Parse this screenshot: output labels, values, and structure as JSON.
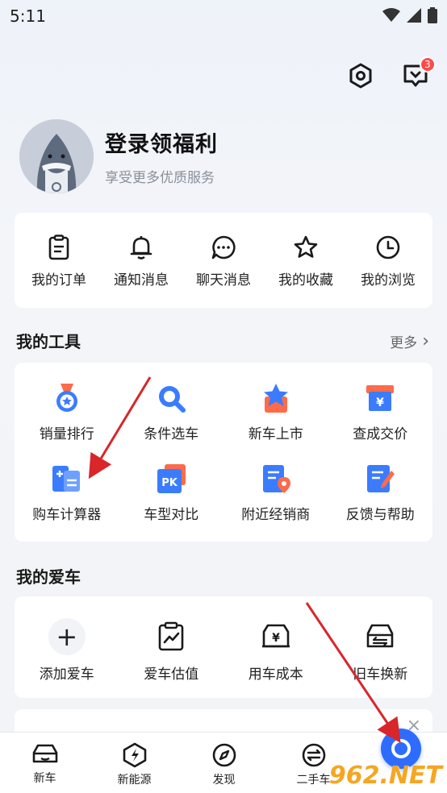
{
  "status": {
    "time": "5:11"
  },
  "header": {
    "messages_badge": "3"
  },
  "profile": {
    "title": "登录领福利",
    "subtitle": "享受更多优质服务"
  },
  "shortcuts": [
    {
      "label": "我的订单",
      "icon": "order-icon"
    },
    {
      "label": "通知消息",
      "icon": "bell-icon"
    },
    {
      "label": "聊天消息",
      "icon": "chat-icon"
    },
    {
      "label": "我的收藏",
      "icon": "star-icon"
    },
    {
      "label": "我的浏览",
      "icon": "clock-icon"
    }
  ],
  "tools": {
    "title": "我的工具",
    "more": "更多",
    "items": [
      {
        "label": "销量排行",
        "icon": "sales-rank-icon"
      },
      {
        "label": "条件选车",
        "icon": "filter-search-icon"
      },
      {
        "label": "新车上市",
        "icon": "new-car-star-icon"
      },
      {
        "label": "查成交价",
        "icon": "price-yen-icon"
      },
      {
        "label": "购车计算器",
        "icon": "calculator-icon"
      },
      {
        "label": "车型对比",
        "icon": "pk-compare-icon"
      },
      {
        "label": "附近经销商",
        "icon": "dealer-location-icon"
      },
      {
        "label": "反馈与帮助",
        "icon": "feedback-icon"
      }
    ]
  },
  "mycar": {
    "title": "我的爱车",
    "items": [
      {
        "label": "添加爱车",
        "icon": "plus-icon",
        "glyph": "+"
      },
      {
        "label": "爱车估值",
        "icon": "valuation-chart-icon"
      },
      {
        "label": "用车成本",
        "icon": "car-cost-yen-icon"
      },
      {
        "label": "旧车换新",
        "icon": "car-trade-in-icon"
      }
    ]
  },
  "tabbar": [
    {
      "label": "新车",
      "icon": "car-icon"
    },
    {
      "label": "新能源",
      "icon": "lightning-icon"
    },
    {
      "label": "发现",
      "icon": "compass-icon"
    },
    {
      "label": "二手车",
      "icon": "used-car-icon"
    }
  ],
  "watermark": "962.NET",
  "close_glyph": "×",
  "more_glyph": "›",
  "colors": {
    "accent": "#2d6cff",
    "badge": "#ff4a4a",
    "arrow": "#d8262a"
  }
}
